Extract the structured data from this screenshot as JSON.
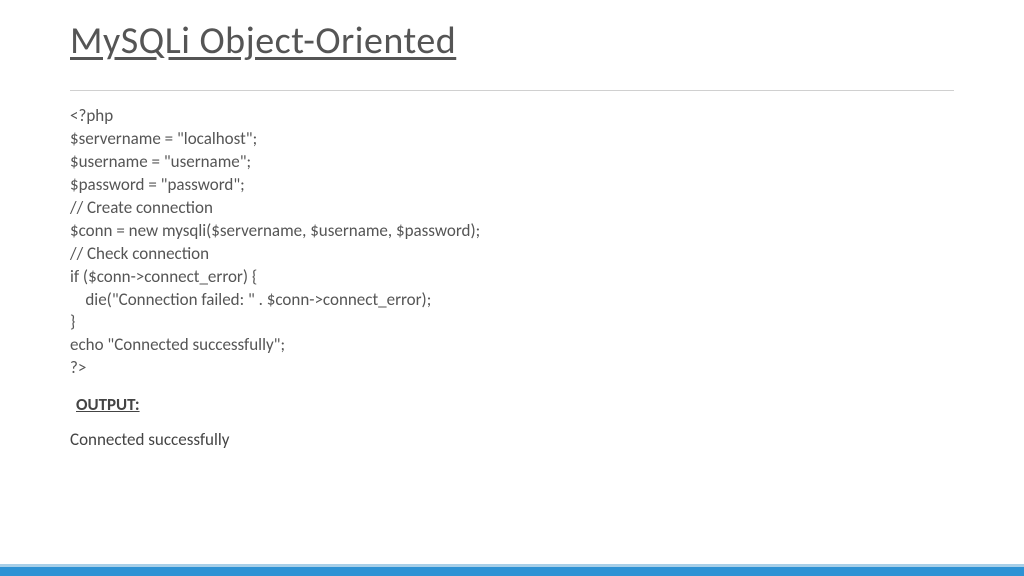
{
  "title": "MySQLi Object-Oriented",
  "code": "<?php\n$servername = \"localhost\";\n$username = \"username\";\n$password = \"password\";\n// Create connection\n$conn = new mysqli($servername, $username, $password);\n// Check connection\nif ($conn->connect_error) {\n    die(\"Connection failed: \" . $conn->connect_error);\n}\necho \"Connected successfully\";\n?>",
  "output_label": "OUTPUT:",
  "output_text": "Connected successfully"
}
